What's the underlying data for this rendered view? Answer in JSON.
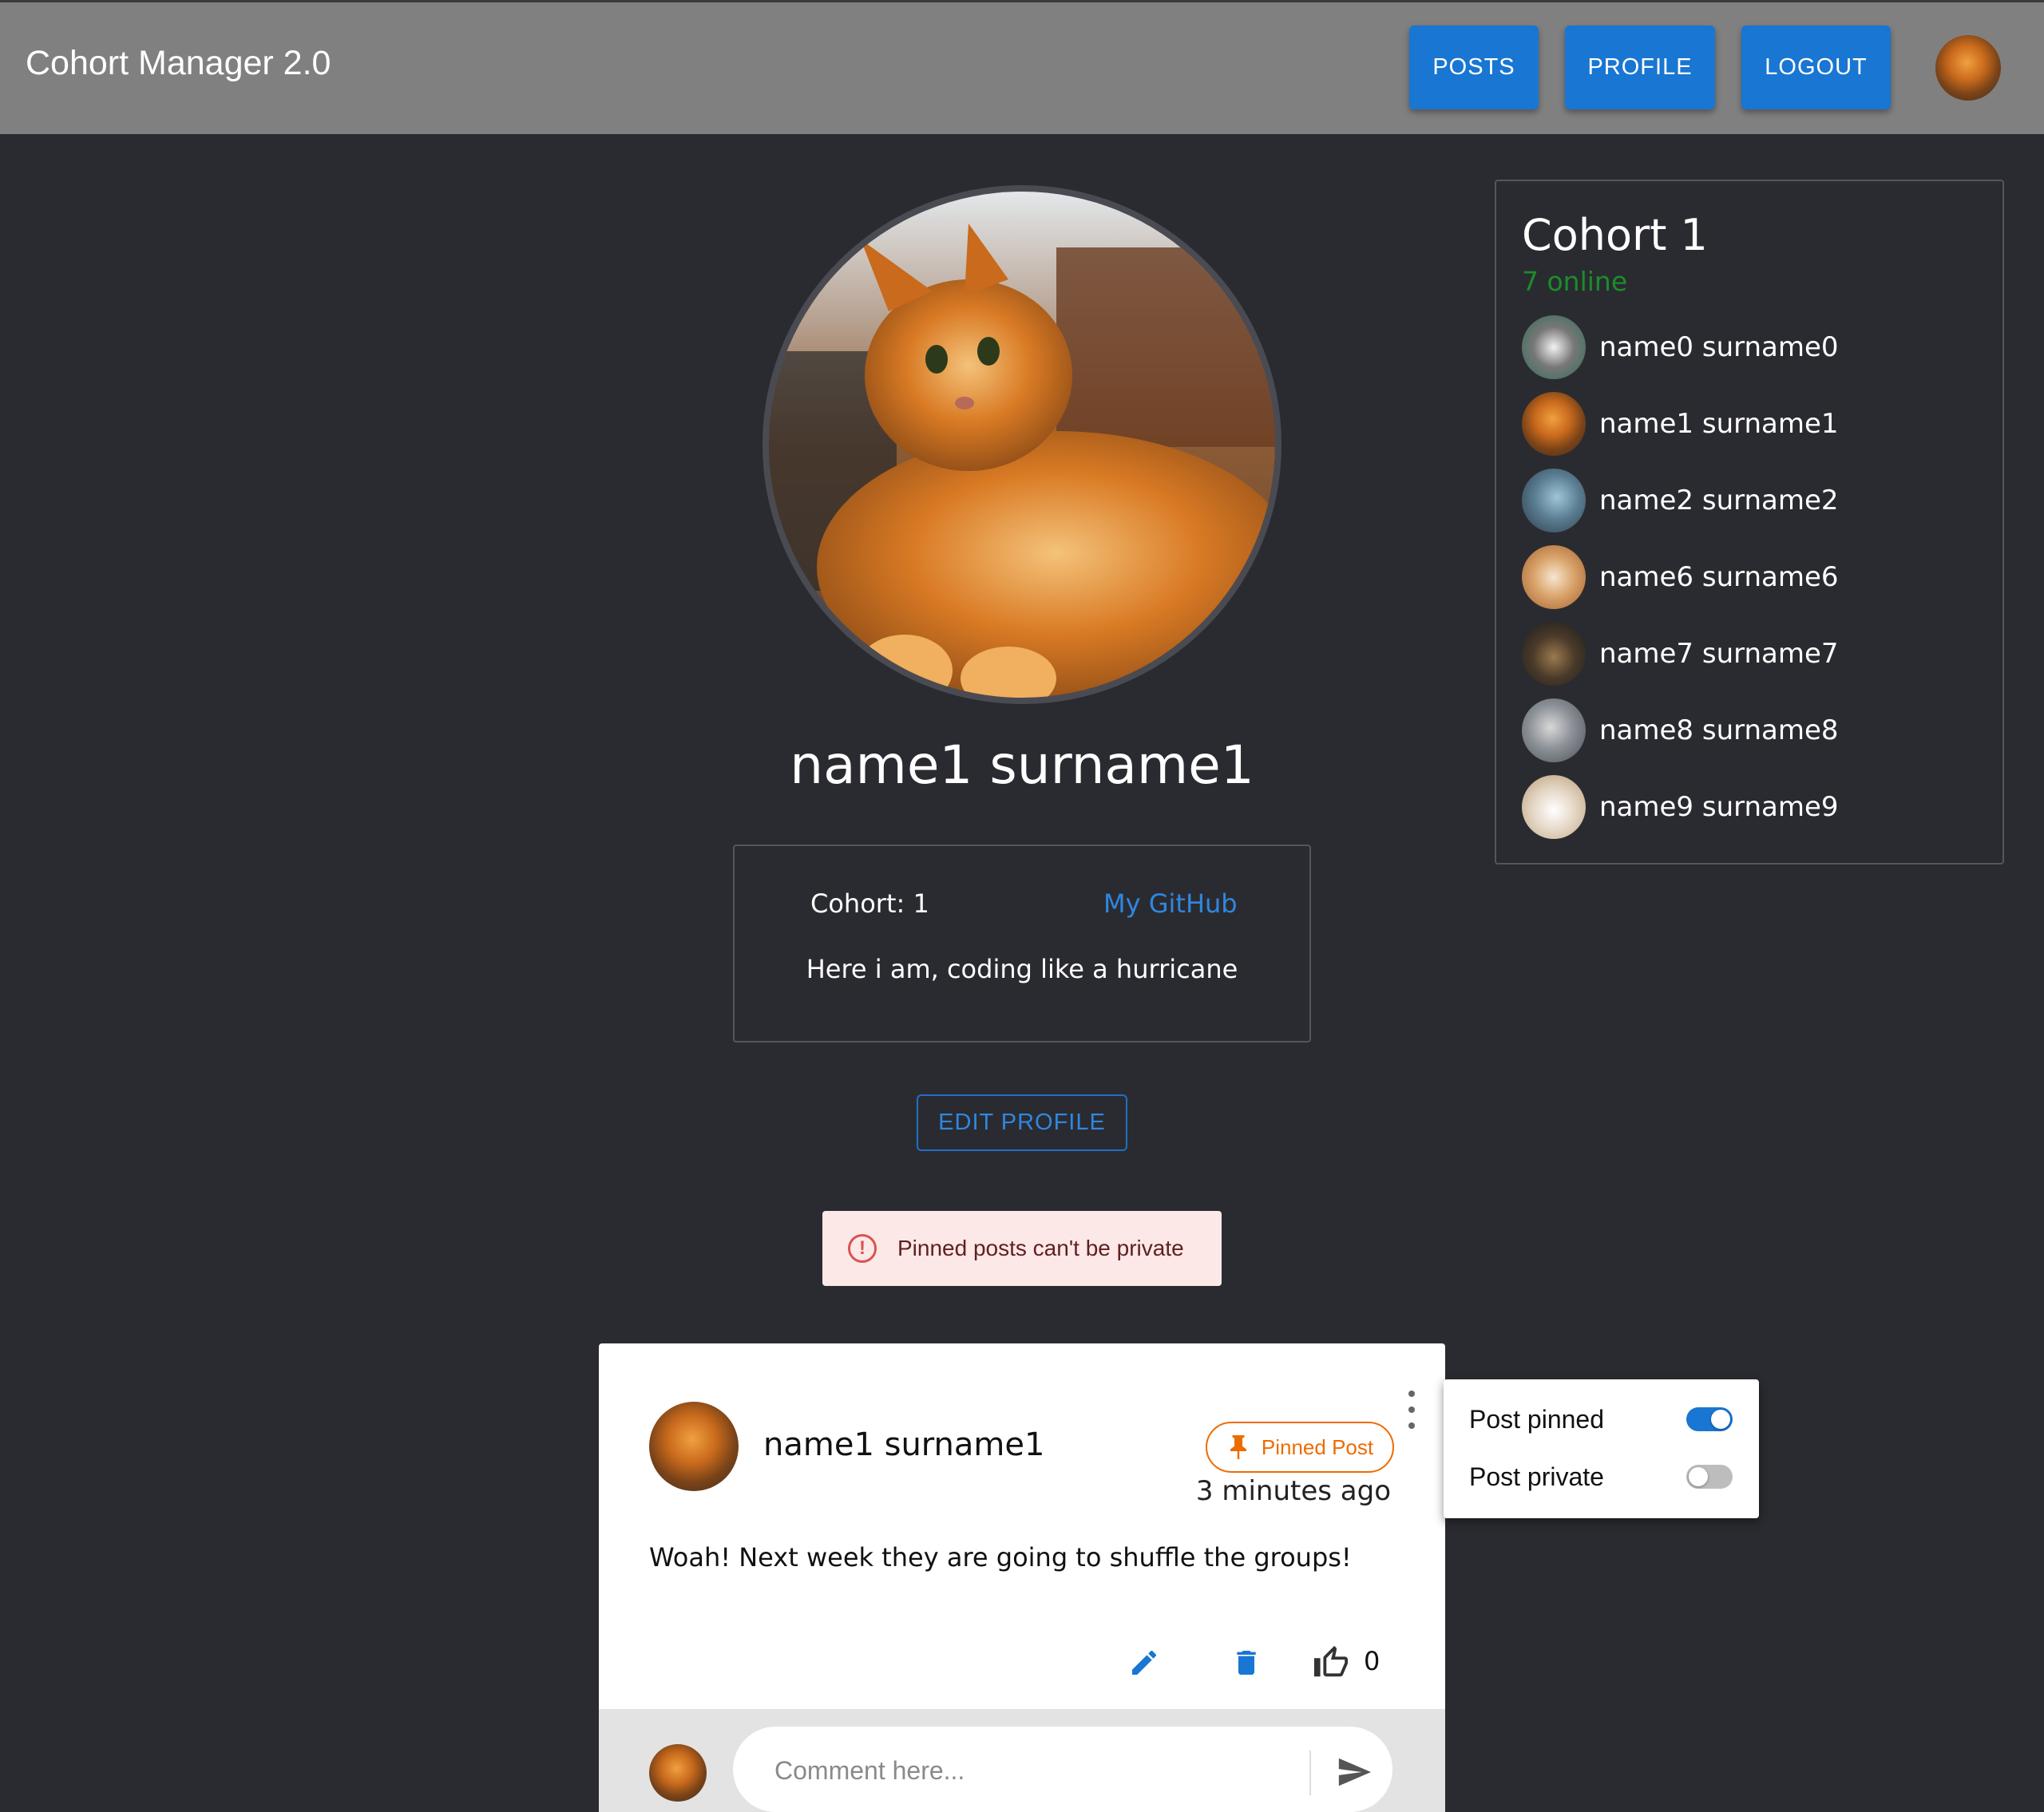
{
  "app": {
    "title": "Cohort Manager 2.0"
  },
  "nav": {
    "posts": "POSTS",
    "profile": "PROFILE",
    "logout": "LOGOUT",
    "avatar_icon": "user-avatar-icon"
  },
  "profile": {
    "name": "name1 surname1",
    "cohort": "Cohort: 1",
    "github": "My GitHub",
    "bio": "Here i am, coding like a hurricane",
    "edit_label": "EDIT PROFILE"
  },
  "alert": {
    "message": "Pinned posts can't be private",
    "icon": "error-outline-icon",
    "color": "#d9534f"
  },
  "cohort_panel": {
    "title": "Cohort 1",
    "online": "7 online",
    "online_color": "#1a8d2a",
    "members": [
      {
        "name": "name0 surname0",
        "avatar": "cat-bw"
      },
      {
        "name": "name1 surname1",
        "avatar": "cat-orange"
      },
      {
        "name": "name2 surname2",
        "avatar": "cat-blue"
      },
      {
        "name": "name6 surname6",
        "avatar": "cat-cream"
      },
      {
        "name": "name7 surname7",
        "avatar": "cat-dark"
      },
      {
        "name": "name8 surname8",
        "avatar": "cat-grey"
      },
      {
        "name": "name9 surname9",
        "avatar": "cat-white"
      }
    ]
  },
  "post": {
    "author": "name1 surname1",
    "badge": "Pinned Post",
    "time": "3 minutes ago",
    "body": "Woah! Next week they are going to shuffle the groups!",
    "likes": "0",
    "comment_placeholder": "Comment here..."
  },
  "post_menu": {
    "pinned_label": "Post pinned",
    "pinned": true,
    "private_label": "Post private",
    "private": false
  },
  "colors": {
    "primary": "#1976d2",
    "warning": "#ed6c02",
    "background": "#2a2b30",
    "appbar": "#808080"
  }
}
